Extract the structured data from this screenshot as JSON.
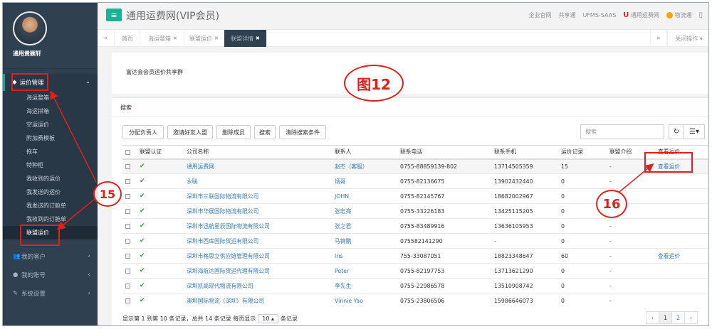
{
  "user": {
    "name": "通用黄颖轩"
  },
  "sidebar": {
    "section": "运价管理",
    "subitems": [
      "海运整箱",
      "海运拼箱",
      "空运运价",
      "附加费模板",
      "拖车",
      "特种柜",
      "我收到的运价",
      "我发送的运价",
      "我发送的订舱单",
      "我收到的订舱单",
      "联盟运价"
    ],
    "menus": [
      "我的客户",
      "我的账号",
      "系统设置"
    ]
  },
  "topbar": {
    "title": "通用运费网(VIP会员)",
    "links": [
      "企业官网",
      "共享通",
      "UFMS-SAAS",
      "通用运费网",
      "物流通"
    ]
  },
  "tabs": [
    "首页",
    "海运整箱",
    "联盟运价",
    "联盟详情"
  ],
  "tabbar": {
    "close_ops": "关闭操作"
  },
  "top_box": {
    "title": "富达会会员运价共享群"
  },
  "search": {
    "header": "搜索",
    "buttons": [
      "分配负责人",
      "邀请好友入盟",
      "删除成员",
      "搜索",
      "清除搜索条件"
    ],
    "placeholder": "搜索"
  },
  "table": {
    "headers": [
      "联盟认证",
      "公司名称",
      "联系人",
      "联系电话",
      "联系手机",
      "运价记录",
      "联盟介绍",
      "查看运价"
    ],
    "rows": [
      {
        "company": "通用运费网",
        "contact": "赵杰（客服）",
        "phone": "0755-88859139-802",
        "mobile": "13714505359",
        "records": "15",
        "intro": "-",
        "view": "查看运价"
      },
      {
        "company": "永联",
        "contact": "炳哥",
        "phone": "0755-82136675",
        "mobile": "13902432440",
        "records": "0",
        "intro": "-",
        "view": ""
      },
      {
        "company": "深圳市三联国际物流有限公司",
        "contact": "JOHN",
        "phone": "0755-82145767",
        "mobile": "18682002967",
        "records": "0",
        "intro": "-",
        "view": ""
      },
      {
        "company": "深圳市华展国际物流有限公司",
        "contact": "张宏亮",
        "phone": "0755-33226183",
        "mobile": "13425115205",
        "records": "0",
        "intro": "-",
        "view": ""
      },
      {
        "company": "深圳市迅航星辰国际物流有限公司",
        "contact": "张之君",
        "phone": "0755-83489916",
        "mobile": "13636105953",
        "records": "0",
        "intro": "-",
        "view": ""
      },
      {
        "company": "深圳市西库国际货运有限公司",
        "contact": "马锦鹏",
        "phone": "075582141290",
        "mobile": "-",
        "records": "0",
        "intro": "-",
        "view": ""
      },
      {
        "company": "深圳市格思立供应链管理有限公司",
        "contact": "Iris",
        "phone": "755-33087051",
        "mobile": "18823348647",
        "records": "60",
        "intro": "-",
        "view": "查看运价"
      },
      {
        "company": "深圳海航达国际货运代理有限公司",
        "contact": "Peter",
        "phone": "0755-82197753",
        "mobile": "13713621290",
        "records": "0",
        "intro": "-",
        "view": ""
      },
      {
        "company": "深圳凯高现代物流有限公司",
        "contact": "李先生",
        "phone": "0755-22986578",
        "mobile": "13510908742",
        "records": "0",
        "intro": "-",
        "view": ""
      },
      {
        "company": "澳圳国际物流（深圳）有限公司",
        "contact": "Vinnie Yao",
        "phone": "0755-23806506",
        "mobile": "15986646073",
        "records": "0",
        "intro": "-",
        "view": ""
      }
    ]
  },
  "footer": {
    "text1": "显示第 1 到第 10 条记录，总共 14 条记录 每页显示",
    "page_size": "10",
    "text2": "条记录",
    "pages": [
      "‹",
      "1",
      "2",
      "›"
    ]
  },
  "annotations": {
    "figure": "图12",
    "n15": "15",
    "n16": "16"
  }
}
